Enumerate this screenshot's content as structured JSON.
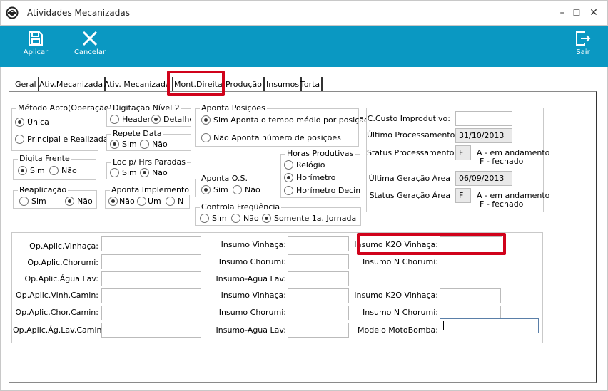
{
  "window": {
    "title": "Atividades Mecanizadas",
    "min": "–",
    "max": "☐",
    "close": "✕"
  },
  "toolbar": {
    "apply": "Aplicar",
    "cancel": "Cancelar",
    "exit": "Sair"
  },
  "tabs": [
    "Geral",
    "Ativ.Mecanizada",
    "Ativ. Mecanizada",
    "Mont.Direita",
    "Produção",
    "Insumos",
    "Torta"
  ],
  "active_tab": "Mont.Direita",
  "groups": {
    "metodo": {
      "title": "Método Apto(Operação)",
      "opts": [
        "Única",
        "Principal e Realizada"
      ],
      "selected": "Única"
    },
    "digitacao": {
      "title": "Digitação Nível 2",
      "opts": [
        "Header",
        "Detalhe"
      ],
      "selected": "Detalhe"
    },
    "repete": {
      "title": "Repete Data",
      "opts": [
        "Sim",
        "Não"
      ],
      "selected": "Sim"
    },
    "aponta_pos": {
      "title": "Aponta Posições",
      "opts": [
        "Sim  Aponta o tempo médio por posição",
        "Não  Aponta número de posições"
      ],
      "selected": "Sim"
    },
    "digita_frente": {
      "title": "Digita Frente",
      "opts": [
        "Sim",
        "Não"
      ],
      "selected": "Sim"
    },
    "loc": {
      "title": "Loc p/ Hrs Paradas",
      "opts": [
        "Sim",
        "Não"
      ],
      "selected": "Não"
    },
    "horas": {
      "title": "Horas Produtivas",
      "opts": [
        "Relógio",
        "Horímetro",
        "Horímetro Decimal"
      ],
      "selected": "Horímetro"
    },
    "aponta_os": {
      "title": "Aponta O.S.",
      "opts": [
        "Sim",
        "Não"
      ],
      "selected": "Sim"
    },
    "reaplicacao": {
      "title": "Reaplicação",
      "opts": [
        "Sim",
        "Não"
      ],
      "selected": "Não"
    },
    "aponta_impl": {
      "title": "Aponta Implemento",
      "opts": [
        "Não",
        "Um",
        "N"
      ],
      "selected": "Não"
    },
    "controla": {
      "title": "Controla Freqüência",
      "opts": [
        "Sim",
        "Não",
        "Somente 1a. Jornada"
      ],
      "selected": "Somente 1a. Jornada"
    }
  },
  "status": {
    "custo_label": "C.Custo Improdutivo:",
    "custo_value": "",
    "ult_proc_label": "Último Processamento:",
    "ult_proc_value": "31/10/2013",
    "status_proc_label": "Status Processamento:",
    "status_proc_value": "F",
    "status_proc_legend_a": "A - em andamento",
    "status_proc_legend_f": "F - fechado",
    "ult_ger_label": "Última Geração Área",
    "ult_ger_value": "06/09/2013",
    "status_ger_label": "Status Geração Área",
    "status_ger_value": "F",
    "status_ger_legend_a": "A - em andamento",
    "status_ger_legend_f": "F - fechado"
  },
  "fields": {
    "col1": [
      "Op.Aplic.Vinhaça:",
      "Op.Aplic.Chorumi:",
      "Op.Aplic.Água Lav:",
      "Op.Aplic.Vinh.Camin:",
      "Op.Aplic.Chor.Camin:",
      "Op.Aplic.Ág.Lav.Camin:"
    ],
    "col2": [
      "Insumo Vinhaça:",
      "Insumo Chorumi:",
      "Insumo-Agua Lav:",
      "Insumo Vinhaça:",
      "Insumo Chorumi:",
      "Insumo-Agua Lav:"
    ],
    "col3": [
      "Insumo K2O Vinhaça:",
      "Insumo N Chorumi:",
      "Insumo K2O Vinhaça:",
      "Insumo N Chorumi:",
      "Modelo MotoBomba:"
    ]
  }
}
